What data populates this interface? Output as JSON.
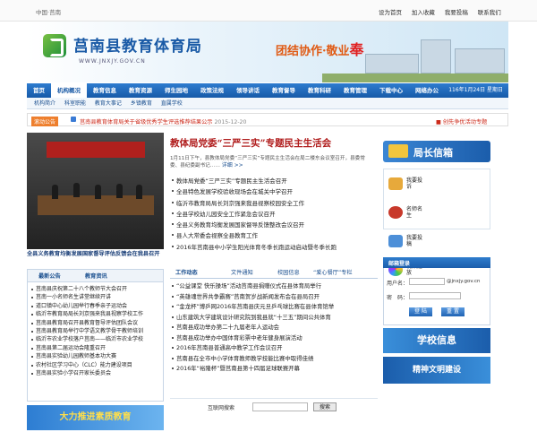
{
  "topbar": {
    "left_text": "中国·莒南",
    "links": [
      "设为首页",
      "加入收藏",
      "我要投稿",
      "联系我们"
    ]
  },
  "header": {
    "site_title": "莒南县教育体育局",
    "site_url": "WWW.JNXJY.GOV.CN",
    "slogan_prefix": "团结协作·敬业",
    "slogan_highlight": "奉"
  },
  "nav": {
    "items": [
      "首页",
      "机构概况",
      "教育信息",
      "教育资源",
      "师生园地",
      "政策法规",
      "领导讲话",
      "教育督导",
      "教育科研",
      "教育管理",
      "下载中心",
      "网络办公"
    ],
    "active_index": 1,
    "date": "116年1月24日 星期日"
  },
  "subnav": [
    "机构简介",
    "科室职能",
    "教育大事记",
    "乡镇教育",
    "直属学校"
  ],
  "notice": {
    "tag": "滚动公告",
    "text": "莒南县教育体育局关于省级优秀学生评选推荐结果公示",
    "date": "2015-12-20",
    "right_text": "■ 创先争优活动专题"
  },
  "photo": {
    "caption": "全县义务教育均衡发展国家督导评估反馈会在我县召开"
  },
  "left_tabs": [
    "最新公告",
    "教育资讯"
  ],
  "left_news": [
    "莒南县庆祝第二十八个教师节大会召开",
    "莒南一小名师名生讲堂继续开讲",
    "道口镇中心幼儿园举行春季亲子运动会",
    "临沂市教育局局长刘京强来我县视察学校工作",
    "莒南县教育局召开县教育督导评估团队会议",
    "莒南县教育局举行中学语文教学骨干教师培训",
    "临沂市农业学校落户莒南——临沂市农业学校",
    "莒南县第二届运动会隆重召开",
    "莒南县实验幼儿园教师基本功大赛",
    "农村社区学习中心（CLC）能力建设项目",
    "莒南县实验小学召开家长委员会"
  ],
  "edu_banner": "大力推进素质教育",
  "feature": {
    "title": "教体局党委“三严三实”专题民主生活会",
    "desc": "1月11日下午，县教体局党委“三严三实”专题民主生活会在局二楼东会议室召开，县委常委、县纪委副书记……",
    "more": "详细 >>"
  },
  "main_news": [
    "教体局党委“三严三实”专题民主生活会召开",
    "全县特色发展学校验收现场会在城关中学召开",
    "临沂市教育局局长刘京强来我县视察校园安全工作",
    "全县学校幼儿园安全工作紧急会议召开",
    "全县义务教育均衡发展国家督导反馈整改会议召开",
    "县人大常委会视察全县教育工作",
    "2016年莒南县中小学生阳光体育冬季长跑运动启动暨冬季长跑"
  ],
  "mid_tabs": [
    "工作动态",
    "文件通知",
    "校园信息",
    "“爱心餐厅”专栏"
  ],
  "mid_news": [
    "“公益课堂 快乐操场”活动莒南县捐赠仪式在县体育局举行",
    "“英雄魂世界共争霸赛”莒南贺岁战新闻发布会在县局召开",
    "“金龙杯”博乒网2016年莒南县庆元旦乒乓球比赛在县体育馆举",
    "山东建筑大学建筑设计研究院到我县就“十三五”期间公共体育",
    "莒南县成功举办第二十九届老年人运动会",
    "莒南县成功举办中国体育彩票中老年健身展演活动",
    "2016年莒南县普通高中教学工作会议召开",
    "莒南县在全市中小学体育教师教学技能比赛中取得佳绩",
    "2016年“裕隆杯”暨莒南县第十四届足球联赛开幕"
  ],
  "search": {
    "label": "互联网搜索",
    "button": "搜索"
  },
  "mailbox": {
    "title": "局长信箱",
    "items": [
      "我要投诉",
      "名师名生",
      "我要投稿",
      "视频播放"
    ],
    "colors": [
      "#e7a93b",
      "#c8392b",
      "#4d8fd8",
      "#7b3fbf"
    ]
  },
  "login": {
    "title": "邮箱登录",
    "user_label": "用户名：",
    "user_domain": "@jnxjy.gov.cn",
    "pass_label": "密　码：",
    "login_btn": "登 陆",
    "reset_btn": "重 置"
  },
  "school_info": "学校信息",
  "civil": "精神文明建设"
}
